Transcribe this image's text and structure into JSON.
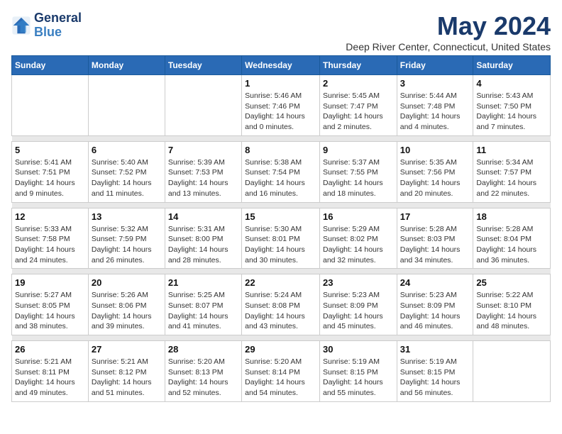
{
  "header": {
    "logo_line1": "General",
    "logo_line2": "Blue",
    "title": "May 2024",
    "subtitle": "Deep River Center, Connecticut, United States"
  },
  "weekdays": [
    "Sunday",
    "Monday",
    "Tuesday",
    "Wednesday",
    "Thursday",
    "Friday",
    "Saturday"
  ],
  "weeks": [
    {
      "days": [
        {
          "number": "",
          "info": ""
        },
        {
          "number": "",
          "info": ""
        },
        {
          "number": "",
          "info": ""
        },
        {
          "number": "1",
          "info": "Sunrise: 5:46 AM\nSunset: 7:46 PM\nDaylight: 14 hours\nand 0 minutes."
        },
        {
          "number": "2",
          "info": "Sunrise: 5:45 AM\nSunset: 7:47 PM\nDaylight: 14 hours\nand 2 minutes."
        },
        {
          "number": "3",
          "info": "Sunrise: 5:44 AM\nSunset: 7:48 PM\nDaylight: 14 hours\nand 4 minutes."
        },
        {
          "number": "4",
          "info": "Sunrise: 5:43 AM\nSunset: 7:50 PM\nDaylight: 14 hours\nand 7 minutes."
        }
      ]
    },
    {
      "days": [
        {
          "number": "5",
          "info": "Sunrise: 5:41 AM\nSunset: 7:51 PM\nDaylight: 14 hours\nand 9 minutes."
        },
        {
          "number": "6",
          "info": "Sunrise: 5:40 AM\nSunset: 7:52 PM\nDaylight: 14 hours\nand 11 minutes."
        },
        {
          "number": "7",
          "info": "Sunrise: 5:39 AM\nSunset: 7:53 PM\nDaylight: 14 hours\nand 13 minutes."
        },
        {
          "number": "8",
          "info": "Sunrise: 5:38 AM\nSunset: 7:54 PM\nDaylight: 14 hours\nand 16 minutes."
        },
        {
          "number": "9",
          "info": "Sunrise: 5:37 AM\nSunset: 7:55 PM\nDaylight: 14 hours\nand 18 minutes."
        },
        {
          "number": "10",
          "info": "Sunrise: 5:35 AM\nSunset: 7:56 PM\nDaylight: 14 hours\nand 20 minutes."
        },
        {
          "number": "11",
          "info": "Sunrise: 5:34 AM\nSunset: 7:57 PM\nDaylight: 14 hours\nand 22 minutes."
        }
      ]
    },
    {
      "days": [
        {
          "number": "12",
          "info": "Sunrise: 5:33 AM\nSunset: 7:58 PM\nDaylight: 14 hours\nand 24 minutes."
        },
        {
          "number": "13",
          "info": "Sunrise: 5:32 AM\nSunset: 7:59 PM\nDaylight: 14 hours\nand 26 minutes."
        },
        {
          "number": "14",
          "info": "Sunrise: 5:31 AM\nSunset: 8:00 PM\nDaylight: 14 hours\nand 28 minutes."
        },
        {
          "number": "15",
          "info": "Sunrise: 5:30 AM\nSunset: 8:01 PM\nDaylight: 14 hours\nand 30 minutes."
        },
        {
          "number": "16",
          "info": "Sunrise: 5:29 AM\nSunset: 8:02 PM\nDaylight: 14 hours\nand 32 minutes."
        },
        {
          "number": "17",
          "info": "Sunrise: 5:28 AM\nSunset: 8:03 PM\nDaylight: 14 hours\nand 34 minutes."
        },
        {
          "number": "18",
          "info": "Sunrise: 5:28 AM\nSunset: 8:04 PM\nDaylight: 14 hours\nand 36 minutes."
        }
      ]
    },
    {
      "days": [
        {
          "number": "19",
          "info": "Sunrise: 5:27 AM\nSunset: 8:05 PM\nDaylight: 14 hours\nand 38 minutes."
        },
        {
          "number": "20",
          "info": "Sunrise: 5:26 AM\nSunset: 8:06 PM\nDaylight: 14 hours\nand 39 minutes."
        },
        {
          "number": "21",
          "info": "Sunrise: 5:25 AM\nSunset: 8:07 PM\nDaylight: 14 hours\nand 41 minutes."
        },
        {
          "number": "22",
          "info": "Sunrise: 5:24 AM\nSunset: 8:08 PM\nDaylight: 14 hours\nand 43 minutes."
        },
        {
          "number": "23",
          "info": "Sunrise: 5:23 AM\nSunset: 8:09 PM\nDaylight: 14 hours\nand 45 minutes."
        },
        {
          "number": "24",
          "info": "Sunrise: 5:23 AM\nSunset: 8:09 PM\nDaylight: 14 hours\nand 46 minutes."
        },
        {
          "number": "25",
          "info": "Sunrise: 5:22 AM\nSunset: 8:10 PM\nDaylight: 14 hours\nand 48 minutes."
        }
      ]
    },
    {
      "days": [
        {
          "number": "26",
          "info": "Sunrise: 5:21 AM\nSunset: 8:11 PM\nDaylight: 14 hours\nand 49 minutes."
        },
        {
          "number": "27",
          "info": "Sunrise: 5:21 AM\nSunset: 8:12 PM\nDaylight: 14 hours\nand 51 minutes."
        },
        {
          "number": "28",
          "info": "Sunrise: 5:20 AM\nSunset: 8:13 PM\nDaylight: 14 hours\nand 52 minutes."
        },
        {
          "number": "29",
          "info": "Sunrise: 5:20 AM\nSunset: 8:14 PM\nDaylight: 14 hours\nand 54 minutes."
        },
        {
          "number": "30",
          "info": "Sunrise: 5:19 AM\nSunset: 8:15 PM\nDaylight: 14 hours\nand 55 minutes."
        },
        {
          "number": "31",
          "info": "Sunrise: 5:19 AM\nSunset: 8:15 PM\nDaylight: 14 hours\nand 56 minutes."
        },
        {
          "number": "",
          "info": ""
        }
      ]
    }
  ]
}
